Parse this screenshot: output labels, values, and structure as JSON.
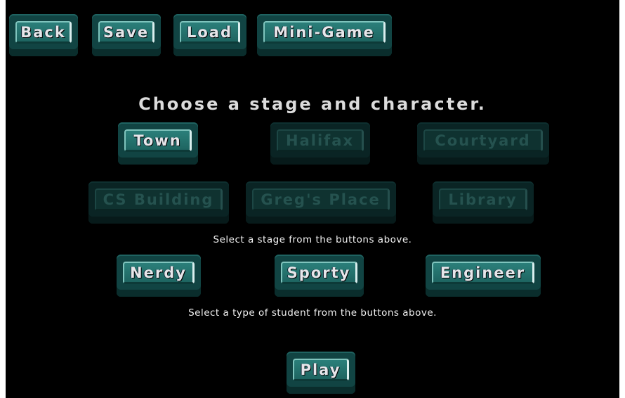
{
  "toolbar": {
    "back_label": "Back",
    "save_label": "Save",
    "load_label": "Load",
    "minigame_label": "Mini-Game"
  },
  "heading": "Choose a stage and character.",
  "stages": {
    "town": {
      "label": "Town",
      "enabled": true
    },
    "halifax": {
      "label": "Halifax",
      "enabled": false
    },
    "courtyard": {
      "label": "Courtyard",
      "enabled": false
    },
    "cs_building": {
      "label": "CS Building",
      "enabled": false
    },
    "gregs_place": {
      "label": "Greg's Place",
      "enabled": false
    },
    "library": {
      "label": "Library",
      "enabled": false
    }
  },
  "stage_hint": "Select a stage from the buttons above.",
  "characters": {
    "nerdy": {
      "label": "Nerdy"
    },
    "sporty": {
      "label": "Sporty"
    },
    "engineer": {
      "label": "Engineer"
    }
  },
  "character_hint": "Select a type of student from the buttons above.",
  "play_label": "Play",
  "colors": {
    "background": "#000000",
    "button_face": "#2b7f7a",
    "button_base": "#114443",
    "button_disabled": "#0f3230",
    "label_text": "#e6e6ea"
  }
}
